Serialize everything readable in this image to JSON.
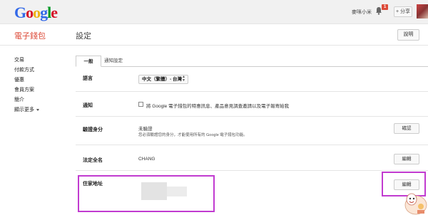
{
  "header": {
    "logo_letters": [
      {
        "ch": "G",
        "color": "#3369e8"
      },
      {
        "ch": "o",
        "color": "#d50f25"
      },
      {
        "ch": "o",
        "color": "#eeb211"
      },
      {
        "ch": "g",
        "color": "#3369e8"
      },
      {
        "ch": "l",
        "color": "#009925"
      },
      {
        "ch": "e",
        "color": "#d50f25"
      }
    ],
    "username": "麥咪小米",
    "notification_count": "1",
    "share_label": "+ 分享"
  },
  "app": {
    "title": "電子錢包",
    "section_title": "設定",
    "help_label": "說明"
  },
  "sidebar": {
    "items": [
      {
        "label": "交易"
      },
      {
        "label": "付款方式"
      },
      {
        "label": "優惠"
      },
      {
        "label": "會員方案"
      },
      {
        "label": "簡介"
      },
      {
        "label": "顯示更多"
      }
    ]
  },
  "tabs": {
    "active": "一般",
    "inactive": "通知設定"
  },
  "settings": {
    "language_label": "語言",
    "language_value": "中文（繁體）- 台灣",
    "notify_label": "通知",
    "notify_text": "將 Google 電子錢包的特惠訊息、產品意見調查邀請以及電子報寄給我",
    "verify_label": "驗證身分",
    "verify_status": "未驗證",
    "verify_desc": "您必須驗證您的身分，才能使用所有的 Google 電子錢包功能。",
    "verify_btn": "確認",
    "legal_name_label": "法定全名",
    "legal_name_value": "CHANG",
    "legal_name_btn": "編輯",
    "address_label": "住家地址",
    "address_btn": "編輯"
  },
  "colors": {
    "accent_red": "#dd4b39",
    "highlight": "#c13bd0"
  }
}
